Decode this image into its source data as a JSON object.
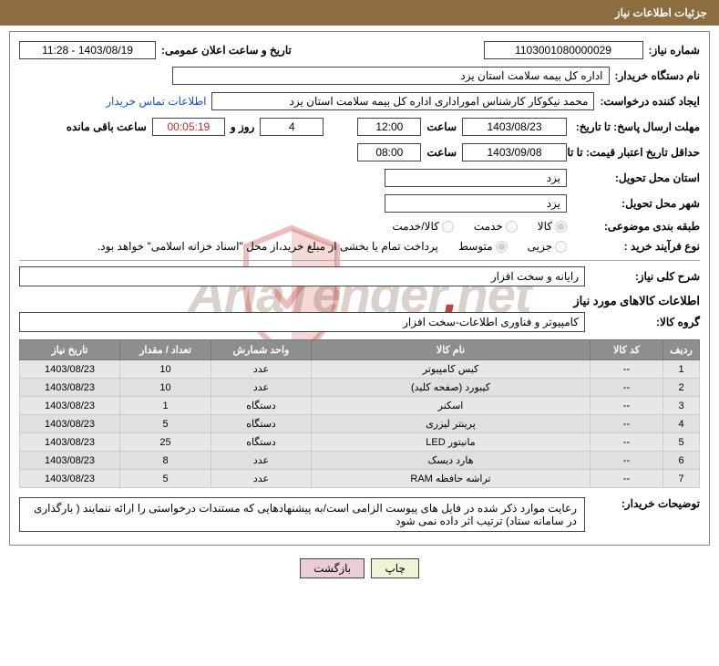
{
  "header": {
    "title": "جزئیات اطلاعات نیاز"
  },
  "watermark": {
    "part1": "AriaTender",
    "dot": ".",
    "part2": "net"
  },
  "labels": {
    "need_number": "شماره نیاز:",
    "announce_datetime": "تاریخ و ساعت اعلان عمومی:",
    "buyer_org": "نام دستگاه خریدار:",
    "requester": "ایجاد کننده درخواست:",
    "buyer_contact_link": "اطلاعات تماس خریدار",
    "response_deadline": "مهلت ارسال پاسخ: تا تاریخ:",
    "hour": "ساعت",
    "days_and": "روز و",
    "remaining": "ساعت باقی مانده",
    "price_validity": "حداقل تاریخ اعتبار قیمت: تا تاریخ:",
    "delivery_province": "استان محل تحویل:",
    "delivery_city": "شهر محل تحویل:",
    "subject_class": "طبقه بندی موضوعی:",
    "purchase_process": "نوع فرآیند خرید :",
    "payment_note": "پرداخت تمام یا بخشی از مبلغ خرید،از محل \"اسناد خزانه اسلامی\" خواهد بود.",
    "general_desc": "شرح کلی نیاز:",
    "goods_info_title": "اطلاعات کالاهای مورد نیاز",
    "goods_group": "گروه کالا:",
    "buyer_notes": "توضیحات خریدار:"
  },
  "fields": {
    "need_number": "1103001080000029",
    "announce_datetime": "1403/08/19 - 11:28",
    "buyer_org": "اداره کل بیمه سلامت استان یزد",
    "requester": "محمد نیکوکار کارشناس اموراداری  اداره کل بیمه سلامت استان یزد",
    "response_date": "1403/08/23",
    "response_time": "12:00",
    "days_remaining": "4",
    "time_remaining": "00:05:19",
    "price_date": "1403/09/08",
    "price_time": "08:00",
    "delivery_province": "یزد",
    "delivery_city": "یزد",
    "general_desc": "رایانه و سخت افزار",
    "goods_group": "کامپیوتر و فناوری اطلاعات-سخت افزار",
    "buyer_notes": "رعایت موارد ذکر شده در فایل های پیوست الزامی است/به پیشنهادهایی که مستندات درخواستی را ارائه ننمایند ( بارگذاری در سامانه ستاد) ترتیب اثر داده نمی شود"
  },
  "radios": {
    "subject": [
      "کالا",
      "خدمت",
      "کالا/خدمت"
    ],
    "process": [
      "جزیی",
      "متوسط"
    ]
  },
  "table": {
    "headers": [
      "ردیف",
      "کد کالا",
      "نام کالا",
      "واحد شمارش",
      "تعداد / مقدار",
      "تاریخ نیاز"
    ],
    "rows": [
      {
        "n": 1,
        "code": "--",
        "name": "کیس کامپیوتر",
        "unit": "عدد",
        "qty": 10,
        "date": "1403/08/23"
      },
      {
        "n": 2,
        "code": "--",
        "name": "کیبورد (صفحه کلید)",
        "unit": "عدد",
        "qty": 10,
        "date": "1403/08/23"
      },
      {
        "n": 3,
        "code": "--",
        "name": "اسکنر",
        "unit": "دستگاه",
        "qty": 1,
        "date": "1403/08/23"
      },
      {
        "n": 4,
        "code": "--",
        "name": "پرینتر لیزری",
        "unit": "دستگاه",
        "qty": 5,
        "date": "1403/08/23"
      },
      {
        "n": 5,
        "code": "--",
        "name": "مانیتور LED",
        "unit": "دستگاه",
        "qty": 25,
        "date": "1403/08/23"
      },
      {
        "n": 6,
        "code": "--",
        "name": "هارد دیسک",
        "unit": "عدد",
        "qty": 8,
        "date": "1403/08/23"
      },
      {
        "n": 7,
        "code": "--",
        "name": "تراشه حافظه RAM",
        "unit": "عدد",
        "qty": 5,
        "date": "1403/08/23"
      }
    ]
  },
  "buttons": {
    "print": "چاپ",
    "back": "بازگشت"
  }
}
